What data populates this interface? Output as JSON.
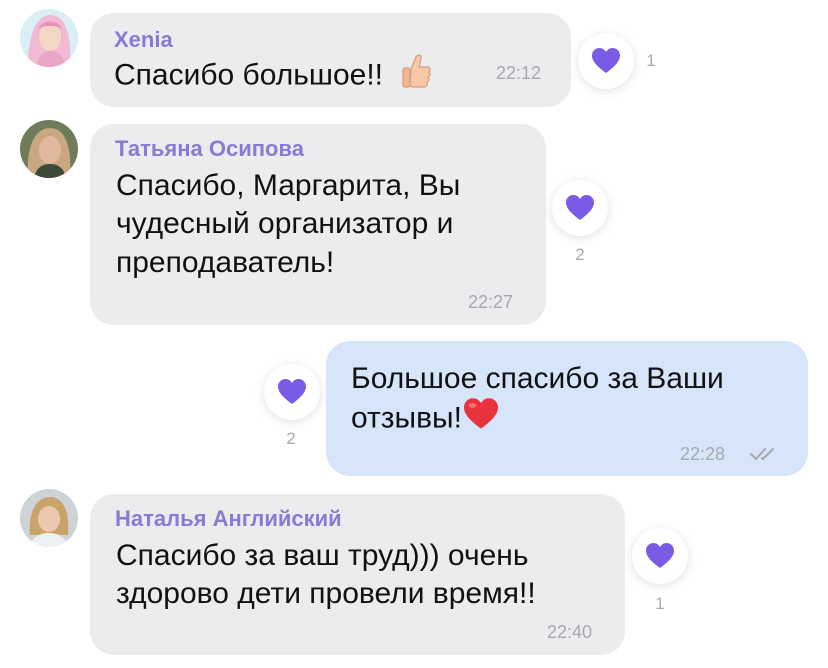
{
  "messages": [
    {
      "author": "Xenia",
      "text_lines": [
        "Спасибо большое!!"
      ],
      "time": "22:12",
      "reaction_count": "1"
    },
    {
      "author": "Татьяна Осипова",
      "text_lines": [
        "Спасибо, Маргарита, Вы",
        "чудесный организатор и",
        "преподаватель!"
      ],
      "time": "22:27",
      "reaction_count": "2"
    },
    {
      "author": "",
      "text_lines": [
        "Большое спасибо за Ваши",
        "отзывы!"
      ],
      "time": "22:28",
      "reaction_count": "2"
    },
    {
      "author": "Наталья Английский",
      "text_lines": [
        "Спасибо за ваш труд))) очень",
        "здорово дети провели время!!"
      ],
      "time": "22:40",
      "reaction_count": "1"
    }
  ],
  "icons": {
    "reaction": "purple-heart-icon",
    "thumbs_up": "thumbs-up-emoji",
    "red_heart": "red-heart-emoji",
    "read_status": "double-check-icon"
  },
  "colors": {
    "incoming_bubble": "#ececee",
    "outgoing_bubble": "#d7e5fa",
    "author_name": "#8b79d6",
    "reaction_heart": "#7b5be6",
    "timestamp": "#a6a9b0"
  }
}
